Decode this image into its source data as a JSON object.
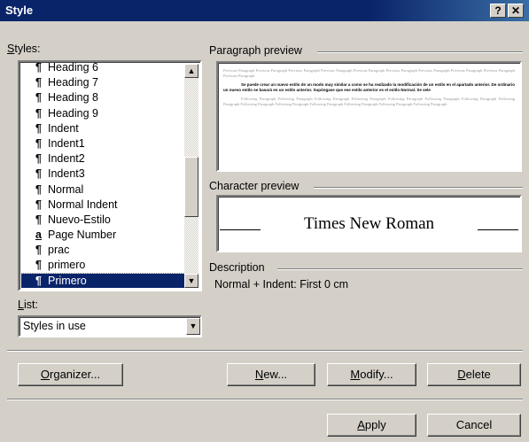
{
  "window": {
    "title": "Style",
    "help_label": "?",
    "close_label": "✕"
  },
  "styles_label_u": "S",
  "styles_label_rest": "tyles:",
  "styles": [
    {
      "glyph": "¶",
      "name": "Heading 6"
    },
    {
      "glyph": "¶",
      "name": "Heading 7"
    },
    {
      "glyph": "¶",
      "name": "Heading 8"
    },
    {
      "glyph": "¶",
      "name": "Heading 9"
    },
    {
      "glyph": "¶",
      "name": "Indent"
    },
    {
      "glyph": "¶",
      "name": "Indent1"
    },
    {
      "glyph": "¶",
      "name": "Indent2"
    },
    {
      "glyph": "¶",
      "name": "Indent3"
    },
    {
      "glyph": "¶",
      "name": "Normal"
    },
    {
      "glyph": "¶",
      "name": "Normal Indent"
    },
    {
      "glyph": "¶",
      "name": "Nuevo-Estilo"
    },
    {
      "glyph": "a",
      "name": "Page Number"
    },
    {
      "glyph": "¶",
      "name": "prac"
    },
    {
      "glyph": "¶",
      "name": "primero"
    },
    {
      "glyph": "¶",
      "name": "Primero",
      "selected": true
    }
  ],
  "paragraph_preview": {
    "label": "Paragraph preview",
    "previous_text": "Previous Paragraph Previous Paragraph Previous Paragraph Previous Paragraph Previous Paragraph Previous Paragraph Previous Paragraph Previous Paragraph Previous Paragraph Previous Paragraph",
    "current_text": "Se puede crear un nuevo estilo de un modo muy similar a como se ha realizado la modificación de un estilo en el apartado anterior. De ordinario un nuevo estilo se basará en un estilo anterior. Supóngase que ese estilo anterior es el estilo Normal. Se sele",
    "following_text": "Following Paragraph Following Paragraph Following Paragraph Following Paragraph Following Paragraph Following Paragraph Following Paragraph Following Paragraph Following Paragraph Following Paragraph Following Paragraph Following Paragraph Following Paragraph Following Paragraph"
  },
  "character_preview": {
    "label": "Character preview",
    "sample": "Times New Roman"
  },
  "description": {
    "label": "Description",
    "text": "Normal + Indent: First  0 cm"
  },
  "list": {
    "label_u": "L",
    "label_rest": "ist:",
    "value": "Styles in use"
  },
  "buttons": {
    "organizer": {
      "u": "O",
      "rest": "rganizer..."
    },
    "new": {
      "u": "N",
      "rest": "ew..."
    },
    "modify": {
      "u": "M",
      "rest": "odify..."
    },
    "delete": {
      "u": "D",
      "rest": "elete"
    },
    "apply": {
      "u": "A",
      "rest": "pply"
    },
    "cancel": {
      "u": "",
      "rest": "Cancel"
    }
  }
}
